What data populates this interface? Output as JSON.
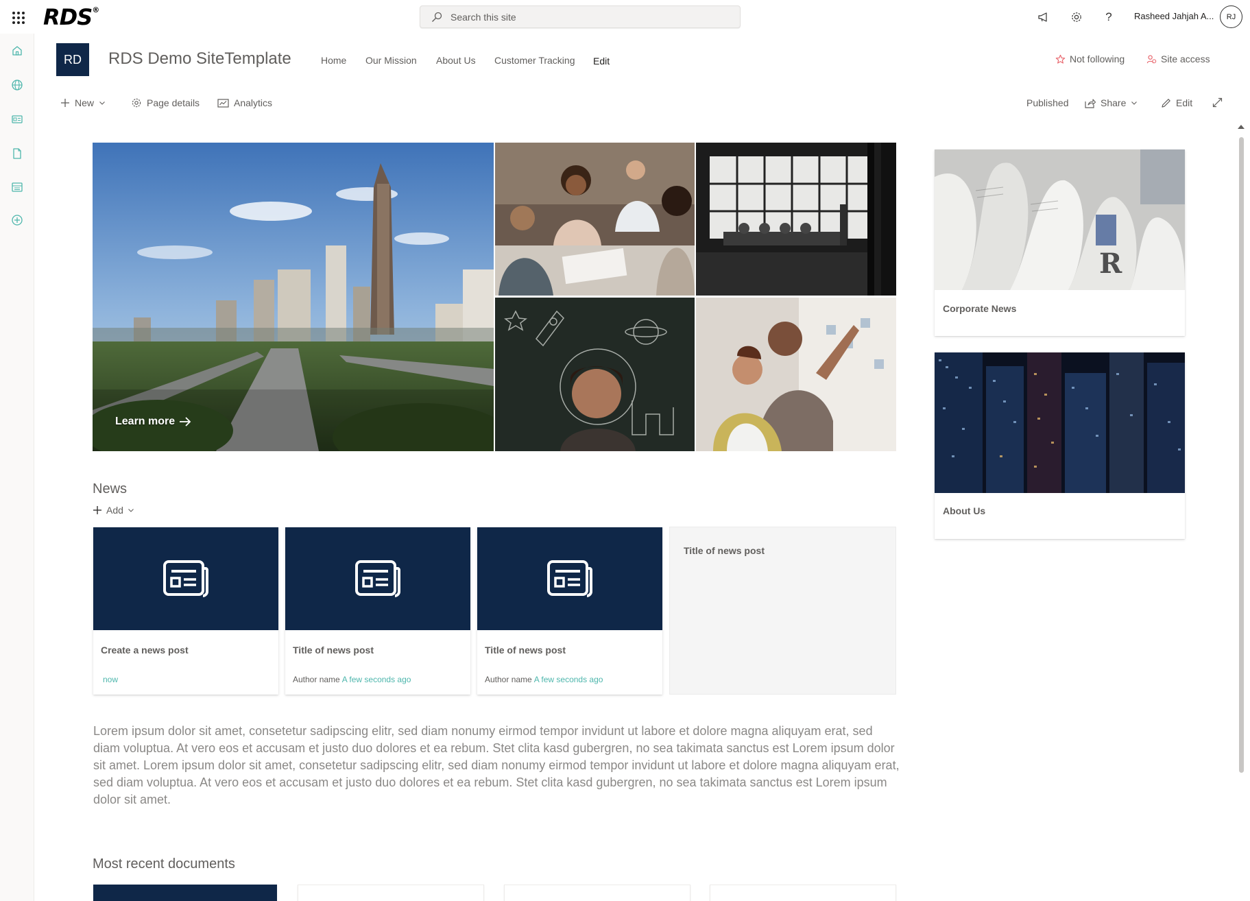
{
  "suite_bar": {
    "logo_text": "RDS",
    "logo_mark": "®",
    "search_placeholder": "Search this site",
    "user_name": "Rasheed Jahjah A...",
    "user_initials": "RJ",
    "icons": [
      "waffle-icon",
      "megaphone-icon",
      "settings-icon",
      "help-icon"
    ]
  },
  "left_rail": {
    "icons": [
      "home-icon",
      "globe-icon",
      "news-icon",
      "document-icon",
      "list-icon",
      "add-circle-icon"
    ],
    "accent": "#4db6ac"
  },
  "site_header": {
    "logo_initials": "RD",
    "title": "RDS Demo SiteTemplate",
    "nav": [
      "Home",
      "Our Mission",
      "About Us",
      "Customer Tracking",
      "Edit"
    ],
    "not_following": "Not following",
    "site_access": "Site access"
  },
  "command_bar": {
    "new": "New",
    "page_details": "Page details",
    "analytics": "Analytics",
    "published": "Published",
    "share": "Share",
    "edit": "Edit"
  },
  "hero": {
    "learn_more": "Learn more"
  },
  "quick_links": [
    {
      "label": "Corporate News"
    },
    {
      "label": "About Us"
    }
  ],
  "news": {
    "title": "News",
    "add_label": "Add",
    "cards": [
      {
        "title": "Create a news post",
        "author": "",
        "time": "now"
      },
      {
        "title": "Title of news post",
        "author": "Author name",
        "time": "A few seconds ago"
      },
      {
        "title": "Title of news post",
        "author": "Author name",
        "time": "A few seconds ago"
      },
      {
        "title": "Title of news post",
        "author": "",
        "time": ""
      }
    ]
  },
  "body_text": "Lorem ipsum dolor sit amet, consetetur sadipscing elitr, sed diam nonumy eirmod tempor invidunt ut labore et dolore magna aliquyam erat, sed diam voluptua. At vero eos et accusam et justo duo dolores et ea rebum. Stet clita kasd gubergren, no sea takimata sanctus est Lorem ipsum dolor sit amet. Lorem ipsum dolor sit amet, consetetur sadipscing elitr, sed diam nonumy eirmod tempor invidunt ut labore et dolore magna aliquyam erat, sed diam voluptua. At vero eos et accusam et justo duo dolores et ea rebum. Stet clita kasd gubergren, no sea takimata sanctus est Lorem ipsum dolor sit amet.",
  "documents": {
    "title": "Most recent documents"
  },
  "colors": {
    "brand_navy": "#0f2748",
    "accent_teal": "#4db6ac",
    "not_following_star": "#e8646b"
  }
}
